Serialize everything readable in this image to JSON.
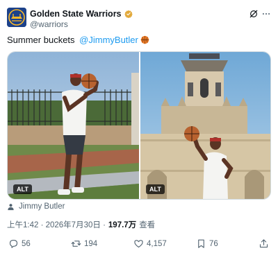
{
  "account": {
    "display_name": "Golden State Warriors",
    "handle": "@warriors",
    "verified_color": "#e2a93b",
    "brand_color": "#1d428a",
    "brand_accent": "#fdb927"
  },
  "tweet": {
    "text_prefix": "Summer buckets ",
    "mention": "@JimmyButler",
    "emoji_icon": "basketball-icon"
  },
  "media": {
    "left_alt": "ALT",
    "right_alt": "ALT"
  },
  "tagged_user": "Jimmy Butler",
  "meta": {
    "timestamp": "上午1:42 · 2026年7月30日 ·",
    "views_count": "197.7万",
    "views_label": "查看"
  },
  "actions": {
    "replies": "56",
    "reposts": "194",
    "likes": "4,157",
    "bookmarks": "76"
  },
  "colors": {
    "link": "#1d9bf0",
    "secondary_text": "#536471",
    "primary_text": "#0f1419"
  }
}
